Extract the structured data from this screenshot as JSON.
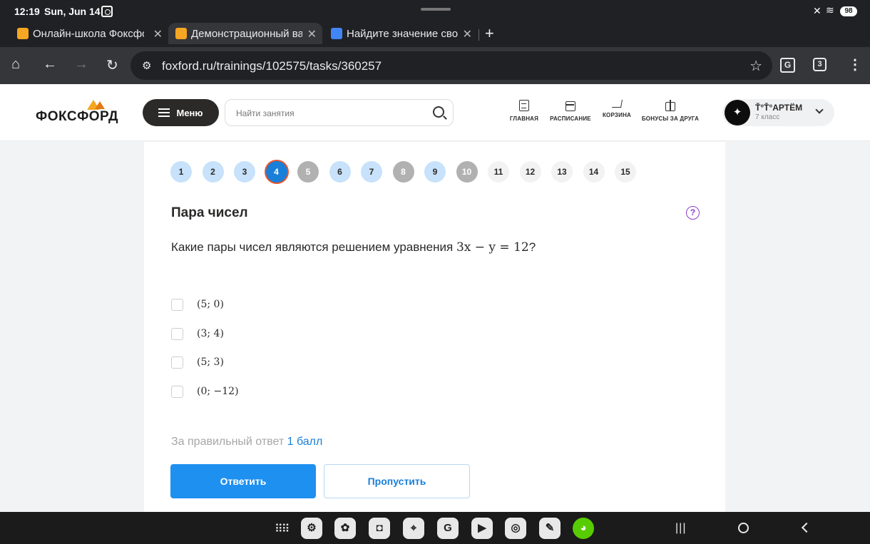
{
  "status_bar": {
    "time": "12:19",
    "date": "Sun, Jun 14",
    "battery": "98"
  },
  "tabs": [
    {
      "title": "Онлайн-школа Фоксфорд",
      "favicon": "foxford-favicon",
      "active": false
    },
    {
      "title": "Демонстрационный вариант",
      "favicon": "foxford-favicon",
      "active": true
    },
    {
      "title": "Найдите значение свободного",
      "favicon": "google-favicon",
      "active": false
    }
  ],
  "toolbar": {
    "url": "foxford.ru/trainings/102575/tasks/360257",
    "tab_count": "3"
  },
  "site": {
    "logo": "ФОКСФОРД",
    "menu_label": "Меню",
    "search_placeholder": "Найти занятия",
    "nav": [
      {
        "label": "ГЛАВНАЯ",
        "icon": "clipboard-icon"
      },
      {
        "label": "РАСПИСАНИЕ",
        "icon": "calendar-icon"
      },
      {
        "label": "КОРЗИНА",
        "icon": "cart-icon"
      },
      {
        "label": "БОНУСЫ ЗА ДРУГА",
        "icon": "gift-icon"
      }
    ],
    "profile": {
      "name": "Ť°Ť°АРТЁМ",
      "class": "7 класс"
    }
  },
  "task": {
    "pages": [
      {
        "n": "1",
        "state": "answered"
      },
      {
        "n": "2",
        "state": "answered"
      },
      {
        "n": "3",
        "state": "answered"
      },
      {
        "n": "4",
        "state": "current"
      },
      {
        "n": "5",
        "state": "skipped"
      },
      {
        "n": "6",
        "state": "answered"
      },
      {
        "n": "7",
        "state": "answered"
      },
      {
        "n": "8",
        "state": "skipped"
      },
      {
        "n": "9",
        "state": "answered"
      },
      {
        "n": "10",
        "state": "skipped"
      },
      {
        "n": "11",
        "state": "unvisited"
      },
      {
        "n": "12",
        "state": "unvisited"
      },
      {
        "n": "13",
        "state": "unvisited"
      },
      {
        "n": "14",
        "state": "unvisited"
      },
      {
        "n": "15",
        "state": "unvisited"
      }
    ],
    "title": "Пара чисел",
    "question_text": "Какие пары чисел являются решением уравнения ",
    "question_math": "3x − y = 12",
    "question_end": "?",
    "options": [
      "(5; 0)",
      "(3; 4)",
      "(5; 3)",
      "(0; −12)"
    ],
    "score_prefix": "За правильный ответ ",
    "score_value": "1 балл",
    "answer_label": "Ответить",
    "skip_label": "Пропустить"
  },
  "colors": {
    "primary": "#1e90f0",
    "answered": "#c7e2fa",
    "skipped": "#b1b1b1",
    "current": "#1a7fd8"
  }
}
